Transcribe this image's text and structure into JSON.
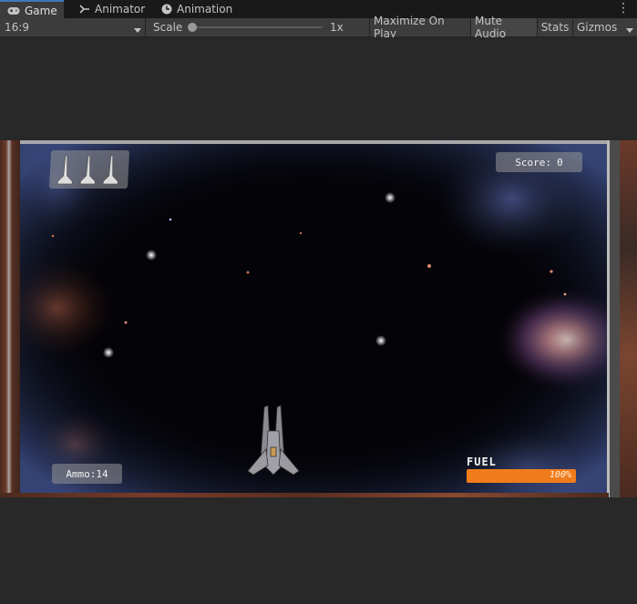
{
  "tabs": [
    {
      "label": "Game",
      "icon": "gamepad-icon",
      "active": true
    },
    {
      "label": "Animator",
      "icon": "animator-icon",
      "active": false
    },
    {
      "label": "Animation",
      "icon": "clock-icon",
      "active": false
    }
  ],
  "toolbar": {
    "aspect": "16:9",
    "scale_label": "Scale",
    "scale_value": "1x",
    "maximize_label": "Maximize On Play",
    "mute_label": "Mute Audio",
    "stats_label": "Stats",
    "gizmos_label": "Gizmos",
    "mute_active": true
  },
  "hud": {
    "score_label": "Score:",
    "score_value": "0",
    "ammo_text": "Ammo:14",
    "fuel_label": "FUEL",
    "fuel_text": "100%",
    "fuel_fraction": 1.0,
    "lives": 3
  },
  "colors": {
    "accent": "#3a79bb",
    "fuel": "#f07c1c",
    "hud_panel": "#969696"
  }
}
